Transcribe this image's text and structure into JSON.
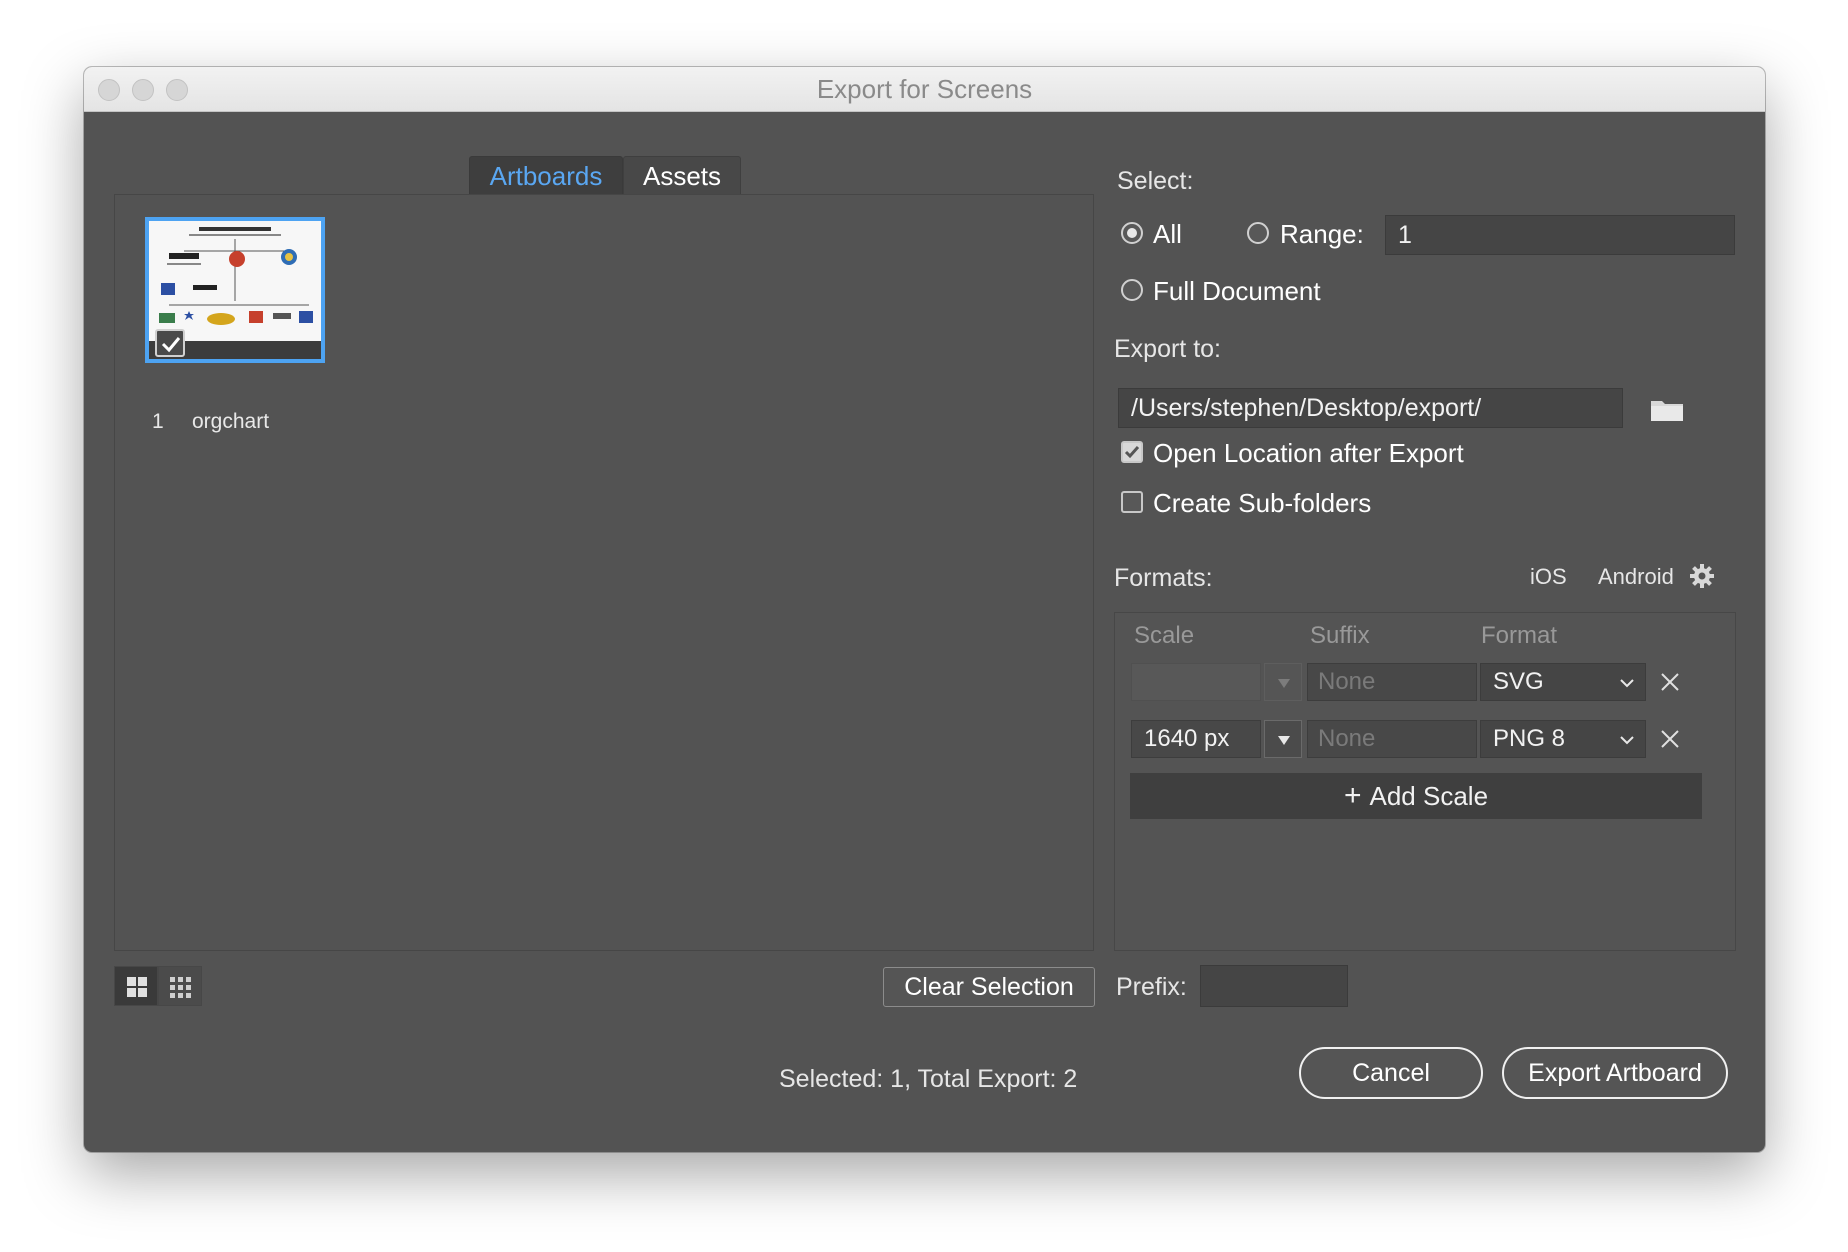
{
  "window": {
    "title": "Export for Screens"
  },
  "tabs": [
    {
      "label": "Artboards",
      "active": true
    },
    {
      "label": "Assets",
      "active": false
    }
  ],
  "artboards": [
    {
      "number": "1",
      "name": "orgchart",
      "selected": true
    }
  ],
  "bottom_left": {
    "clear_selection_label": "Clear Selection",
    "status_text": "Selected: 1, Total Export: 2"
  },
  "select": {
    "label": "Select:",
    "all_label": "All",
    "range_label": "Range:",
    "range_value": "1",
    "full_document_label": "Full Document",
    "selected_option": "All"
  },
  "export_to": {
    "label": "Export to:",
    "path": "/Users/stephen/Desktop/export/",
    "open_location_label": "Open Location after Export",
    "open_location_checked": true,
    "subfolders_label": "Create Sub-folders",
    "subfolders_checked": false
  },
  "formats": {
    "label": "Formats:",
    "ios_label": "iOS",
    "android_label": "Android",
    "columns": {
      "scale": "Scale",
      "suffix": "Suffix",
      "format": "Format"
    },
    "rows": [
      {
        "scale": "",
        "suffix_placeholder": "None",
        "format": "SVG"
      },
      {
        "scale": "1640 px",
        "suffix_placeholder": "None",
        "format": "PNG 8"
      }
    ],
    "add_scale_label": "Add Scale"
  },
  "prefix": {
    "label": "Prefix:",
    "value": ""
  },
  "actions": {
    "cancel_label": "Cancel",
    "export_label": "Export Artboard"
  },
  "colors": {
    "accent": "#5aa7f2",
    "background": "#535353"
  }
}
